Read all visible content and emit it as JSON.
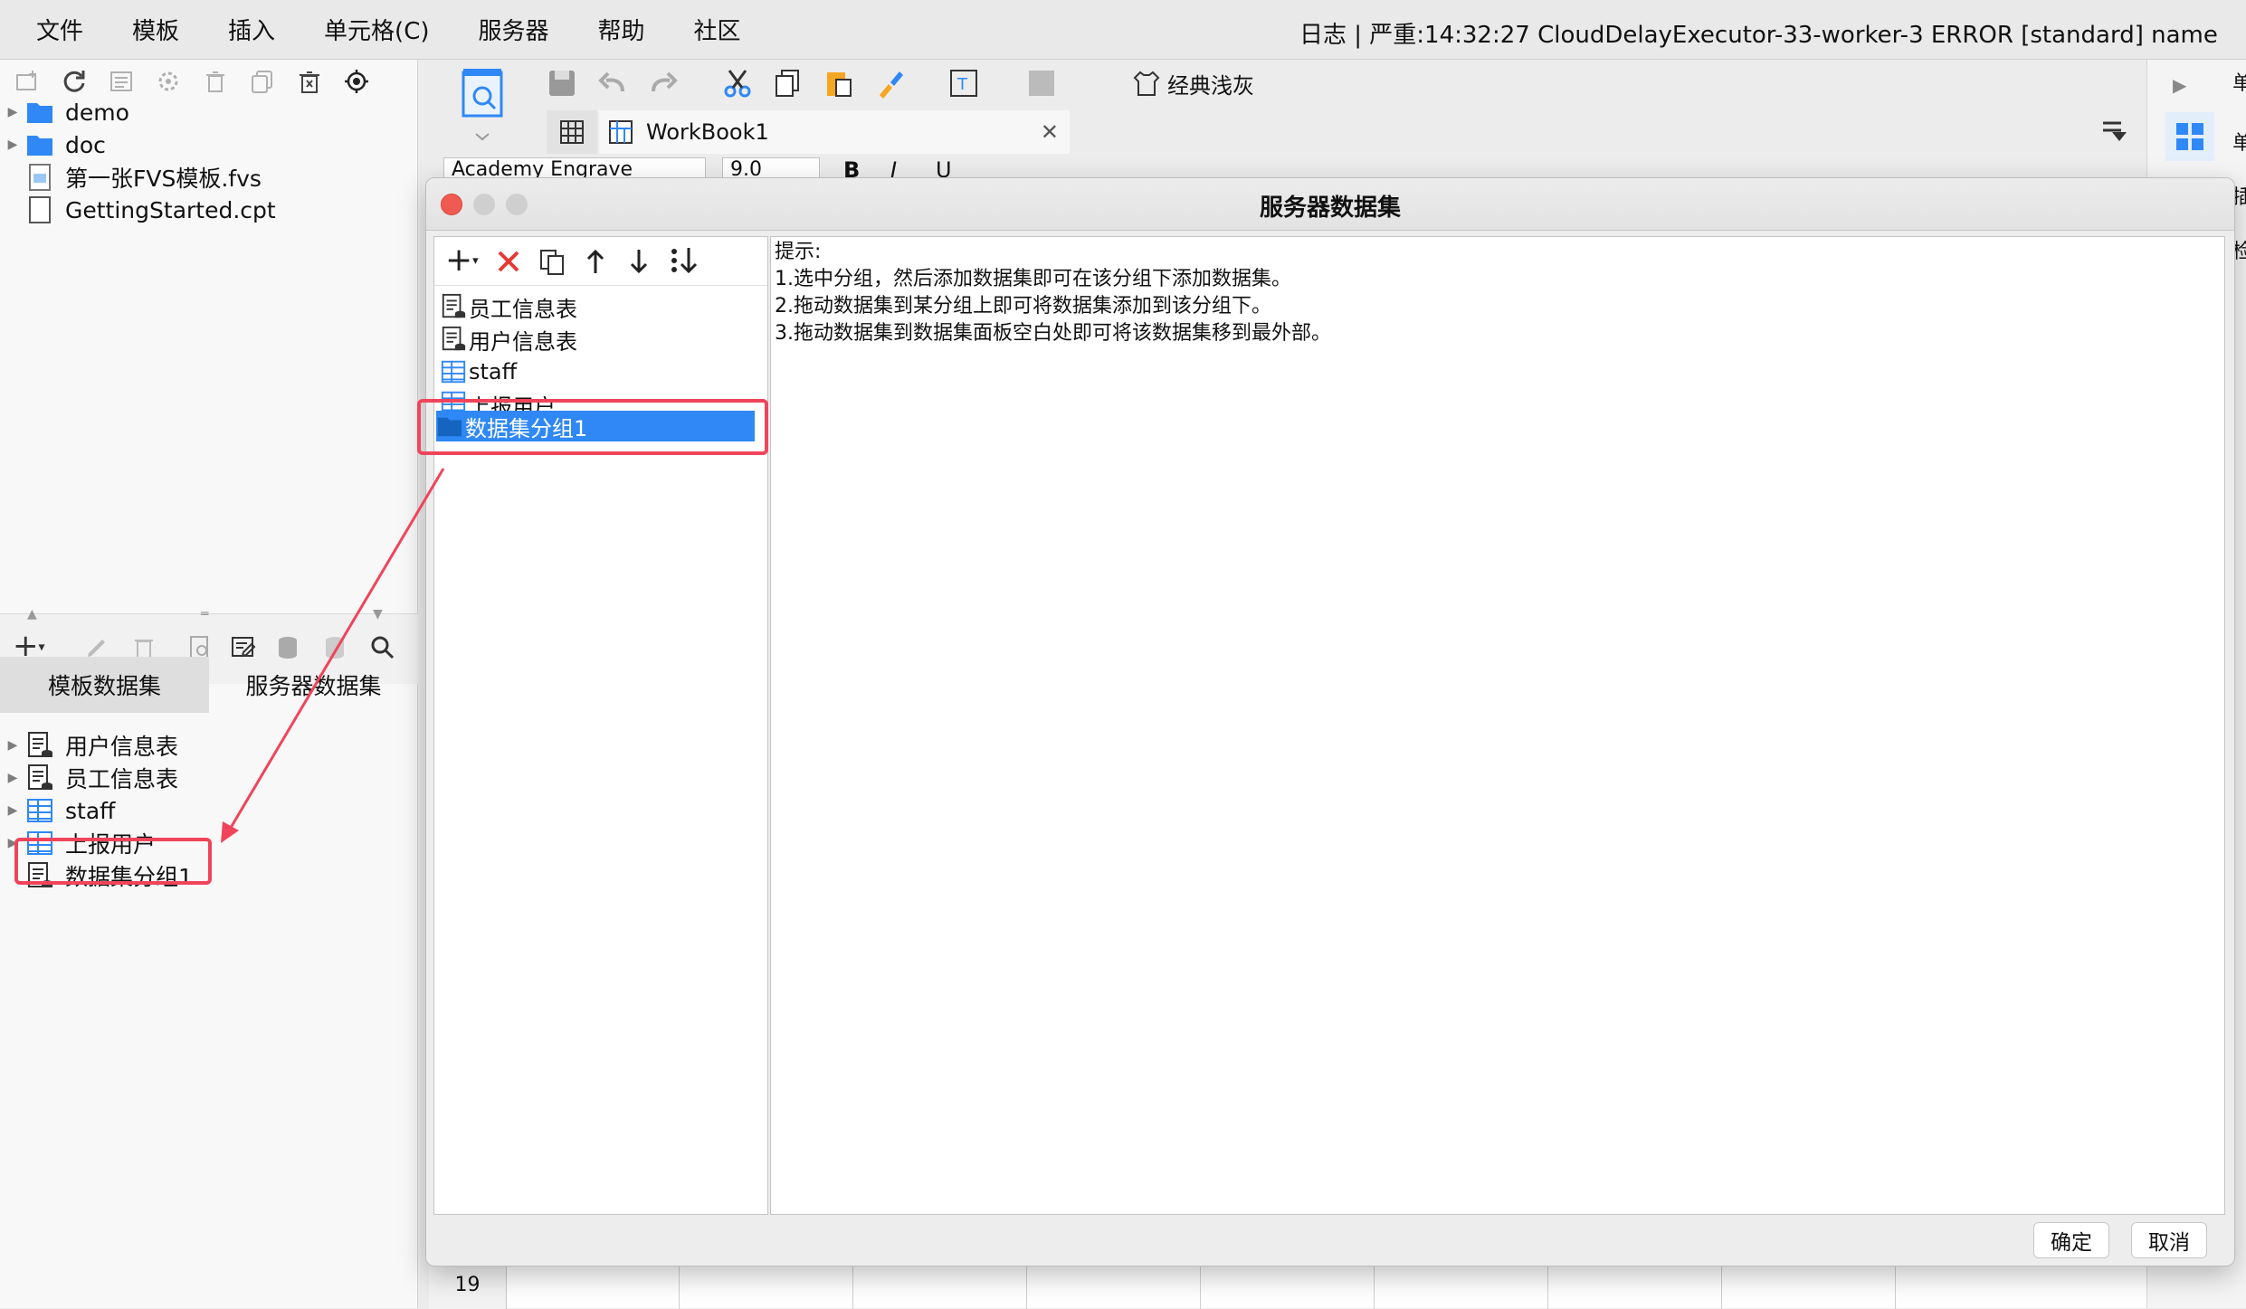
{
  "menubar": {
    "items": [
      "文件",
      "模板",
      "插入",
      "单元格(C)",
      "服务器",
      "帮助",
      "社区"
    ],
    "log_status": "日志 | 严重:14:32:27 CloudDelayExecutor-33-worker-3 ERROR [standard] name"
  },
  "file_tree": {
    "items": [
      {
        "label": "demo",
        "type": "folder"
      },
      {
        "label": "doc",
        "type": "folder"
      },
      {
        "label": "第一张FVS模板.fvs",
        "type": "fvs-file"
      },
      {
        "label": "GettingStarted.cpt",
        "type": "cpt-file"
      }
    ]
  },
  "dataset_panel": {
    "tabs": [
      "模板数据集",
      "服务器数据集"
    ],
    "items": [
      "用户信息表",
      "员工信息表",
      "staff",
      "上报用户",
      "数据集分组1"
    ]
  },
  "editor": {
    "theme_label": "经典浅灰",
    "workbook_tab": "WorkBook1",
    "font_name": "Academy Engrave",
    "font_size": "9.0",
    "row_number": "19"
  },
  "right_strip": {
    "chars": [
      "单",
      "单",
      "插",
      "检"
    ]
  },
  "dialog": {
    "title": "服务器数据集",
    "list_items": [
      "员工信息表",
      "用户信息表",
      "staff",
      "上报用户",
      "数据集分组1"
    ],
    "selected_item": "数据集分组1",
    "hint": [
      "提示:",
      "1.选中分组，然后添加数据集即可在该分组下添加数据集。",
      "2.拖动数据集到某分组上即可将数据集添加到该分组下。",
      "3.拖动数据集到数据集面板空白处即可将该数据集移到最外部。"
    ],
    "ok_label": "确定",
    "cancel_label": "取消"
  },
  "colors": {
    "selection": "#2f88f5",
    "highlight": "#f0445b",
    "delete_red": "#e53935"
  }
}
